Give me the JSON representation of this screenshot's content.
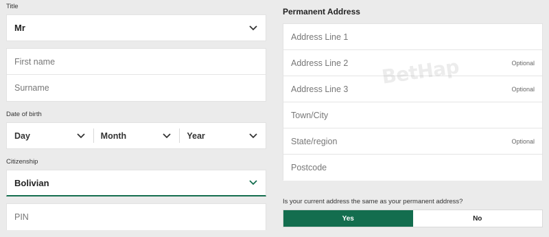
{
  "left": {
    "title_label": "Title",
    "title_value": "Mr",
    "first_name_placeholder": "First name",
    "surname_placeholder": "Surname",
    "dob_label": "Date of birth",
    "dob_day": "Day",
    "dob_month": "Month",
    "dob_year": "Year",
    "citizenship_label": "Citizenship",
    "citizenship_value": "Bolivian",
    "pin_placeholder": "PIN"
  },
  "right": {
    "heading": "Permanent Address",
    "fields": [
      {
        "label": "Address Line 1",
        "optional": ""
      },
      {
        "label": "Address Line 2",
        "optional": "Optional"
      },
      {
        "label": "Address Line 3",
        "optional": "Optional"
      },
      {
        "label": "Town/City",
        "optional": ""
      },
      {
        "label": "State/region",
        "optional": "Optional"
      },
      {
        "label": "Postcode",
        "optional": ""
      }
    ],
    "question": "Is your current address the same as your permanent address?",
    "yes_label": "Yes",
    "no_label": "No"
  },
  "watermark": "BetHap",
  "colors": {
    "accent": "#136d4e",
    "background": "#ebebeb"
  }
}
